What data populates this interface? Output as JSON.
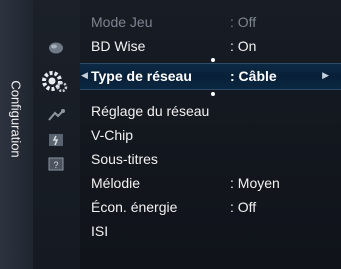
{
  "sidebar": {
    "title": "Configuration"
  },
  "icons": [
    "picture-icon",
    "setup-icon",
    "input-icon",
    "channel-icon",
    "support-icon"
  ],
  "menu": {
    "items": [
      {
        "label": "Mode Jeu",
        "value": ": Off",
        "state": "disabled"
      },
      {
        "label": "BD Wise",
        "value": ": On",
        "state": "normal"
      },
      {
        "label": "Type de réseau",
        "value": ": Câble",
        "state": "selected"
      },
      {
        "label": "Réglage du réseau",
        "value": "",
        "state": "normal"
      },
      {
        "label": "V-Chip",
        "value": "",
        "state": "normal"
      },
      {
        "label": "Sous-titres",
        "value": "",
        "state": "normal"
      },
      {
        "label": "Mélodie",
        "value": ": Moyen",
        "state": "normal"
      },
      {
        "label": "Écon. énergie",
        "value": ": Off",
        "state": "normal"
      },
      {
        "label": "ISI",
        "value": "",
        "state": "normal"
      }
    ]
  },
  "colors": {
    "selected_bg": "#082038",
    "text": "#f2f2f2",
    "disabled_text": "#7e8590"
  }
}
